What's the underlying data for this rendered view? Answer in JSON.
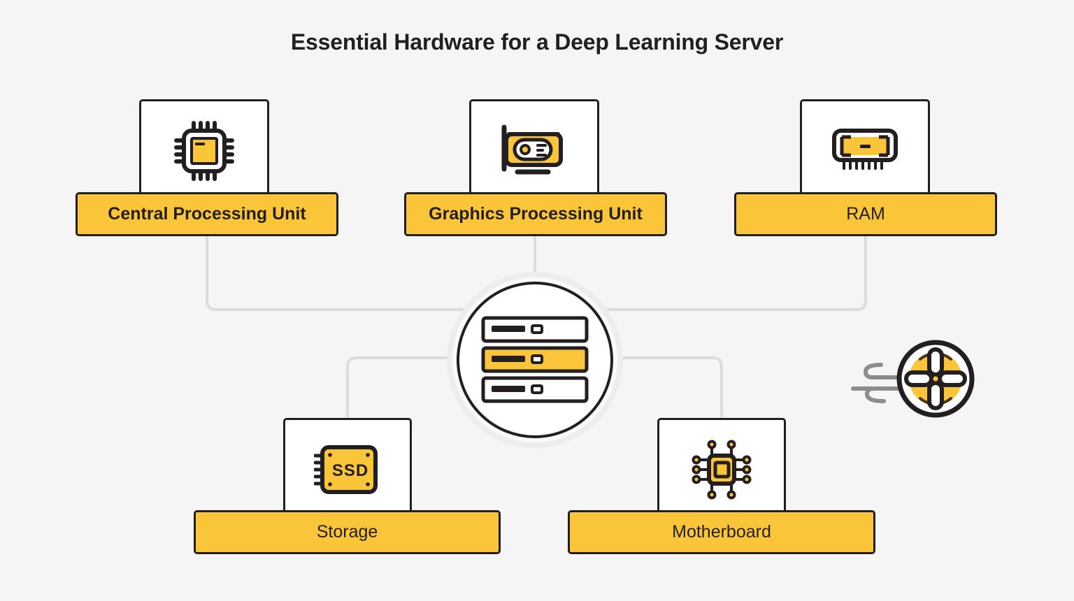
{
  "title": "Essential Hardware for a Deep Learning Server",
  "colors": {
    "background": "#f5f5f5",
    "accent_yellow": "#fbc53a",
    "ink": "#231f20",
    "connector_gray": "#dcdcdc",
    "ring_gray": "#ededed",
    "airflow_gray": "#8c8c8c",
    "card_white": "#ffffff"
  },
  "center": {
    "name": "deep-learning-server",
    "icon": "server-rack-icon",
    "rack_units": 3,
    "highlighted_unit": 2
  },
  "decoration": {
    "fan": {
      "icon": "cooling-fan-icon",
      "airflow_lines": 3
    }
  },
  "nodes": [
    {
      "id": "cpu",
      "label": "Central Processing Unit",
      "icon": "cpu-chip-icon",
      "weight": "bold",
      "position": "top-left"
    },
    {
      "id": "gpu",
      "label": "Graphics Processing Unit",
      "icon": "graphics-card-icon",
      "weight": "semi",
      "position": "top-center"
    },
    {
      "id": "ram",
      "label": "RAM",
      "icon": "memory-module-icon",
      "weight": "reg",
      "position": "top-right"
    },
    {
      "id": "storage",
      "label": "Storage",
      "icon": "ssd-icon",
      "icon_text": "SSD",
      "weight": "reg",
      "position": "bottom-left"
    },
    {
      "id": "motherboard",
      "label": "Motherboard",
      "icon": "motherboard-circuit-icon",
      "weight": "reg",
      "position": "bottom-right"
    }
  ]
}
